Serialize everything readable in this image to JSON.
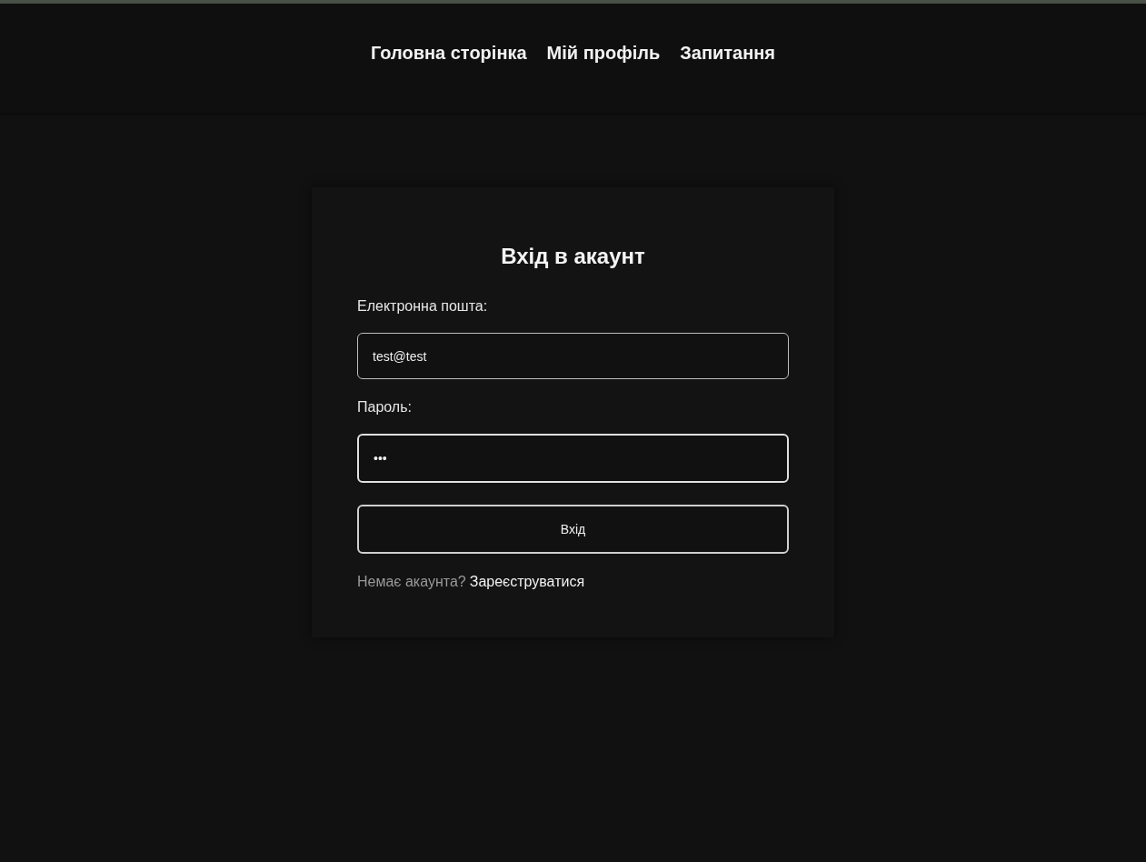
{
  "nav": {
    "links": [
      "Головна сторінка",
      "Мій профіль",
      "Запитання"
    ]
  },
  "login": {
    "title": "Вхід в акаунт",
    "fields": [
      {
        "label": "Електронна пошта:",
        "value": "test@test",
        "focused": false
      },
      {
        "label": "Пароль:",
        "value": "•••",
        "focused": true
      }
    ],
    "submit": "Вхід",
    "footer": {
      "prompt": "Немає акаунта?",
      "link": "Зареєструватися"
    }
  }
}
